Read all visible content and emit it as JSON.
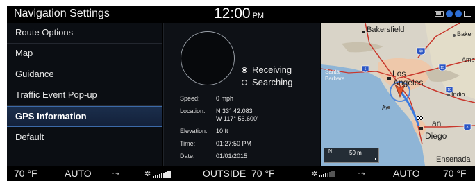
{
  "status_bar": {
    "title": "Navigation Settings",
    "time": "12:00",
    "ampm": "PM",
    "icons": [
      "battery-icon",
      "bluetooth-icon",
      "bluetooth-icon",
      "signal-icon"
    ]
  },
  "menu": {
    "items": [
      {
        "label": "Route Options"
      },
      {
        "label": "Map"
      },
      {
        "label": "Guidance"
      },
      {
        "label": "Traffic Event Pop-up"
      },
      {
        "label": "GPS Information",
        "active": true
      },
      {
        "label": "Default"
      }
    ]
  },
  "gps": {
    "status_options": [
      {
        "label": "Receiving",
        "selected": true
      },
      {
        "label": "Searching",
        "selected": false
      }
    ],
    "speed_label": "Speed:",
    "speed_value": "0 mph",
    "location_label": "Location:",
    "latitude": "N 33° 42.083'",
    "longitude": "W 117° 56.600'",
    "elevation_label": "Elevation:",
    "elevation_value": "10 ft",
    "time_label": "Time:",
    "time_value": "01:27:50 PM",
    "date_label": "Date:",
    "date_value": "01/01/2015"
  },
  "map": {
    "labels": {
      "bakersfield": "Bakersfield",
      "baker": "Baker",
      "amb": "Amb",
      "santa_barbara_1": "Santa",
      "santa_barbara_2": "Barbara",
      "los_angeles_1": "Los",
      "los_angeles_2": "Angeles",
      "indio": "Indio",
      "av": "Av",
      "san": "an",
      "diego": "Diego",
      "ensenada": "Ensenada"
    },
    "highway_shields": [
      "40",
      "5",
      "15",
      "10",
      "8"
    ],
    "scale_north": "N",
    "scale_text": "50 mi",
    "colors": {
      "land": "#d9d4c8",
      "water": "#8fb5d6",
      "urban": "#f0c7a6",
      "highway": "#c9372c",
      "vehicle": "#e0552a"
    }
  },
  "climate": {
    "left_temp": "70 °F",
    "left_mode": "AUTO",
    "outside_label": "OUTSIDE",
    "outside_temp": "70 °F",
    "right_mode": "AUTO",
    "right_temp": "70 °F"
  }
}
